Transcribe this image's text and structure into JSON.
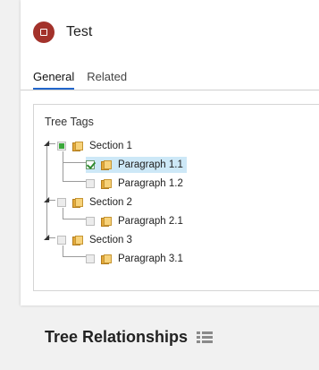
{
  "record": {
    "title": "Test"
  },
  "tabs": [
    {
      "label": "General"
    },
    {
      "label": "Related"
    }
  ],
  "tree_panel": {
    "label": "Tree Tags",
    "nodes": [
      {
        "label": "Section 1",
        "state": "partial"
      },
      {
        "label": "Paragraph 1.1",
        "state": "checked",
        "selected": true
      },
      {
        "label": "Paragraph 1.2",
        "state": "unchecked"
      },
      {
        "label": "Section 2",
        "state": "unchecked"
      },
      {
        "label": "Paragraph 2.1",
        "state": "unchecked"
      },
      {
        "label": "Section 3",
        "state": "unchecked"
      },
      {
        "label": "Paragraph 3.1",
        "state": "unchecked"
      }
    ]
  },
  "relationships": {
    "title": "Tree Relationships"
  },
  "colors": {
    "record_icon": "#a3322b",
    "tab_underline": "#2266cc",
    "selection": "#cde8f7",
    "check": "#2e8b2e"
  }
}
